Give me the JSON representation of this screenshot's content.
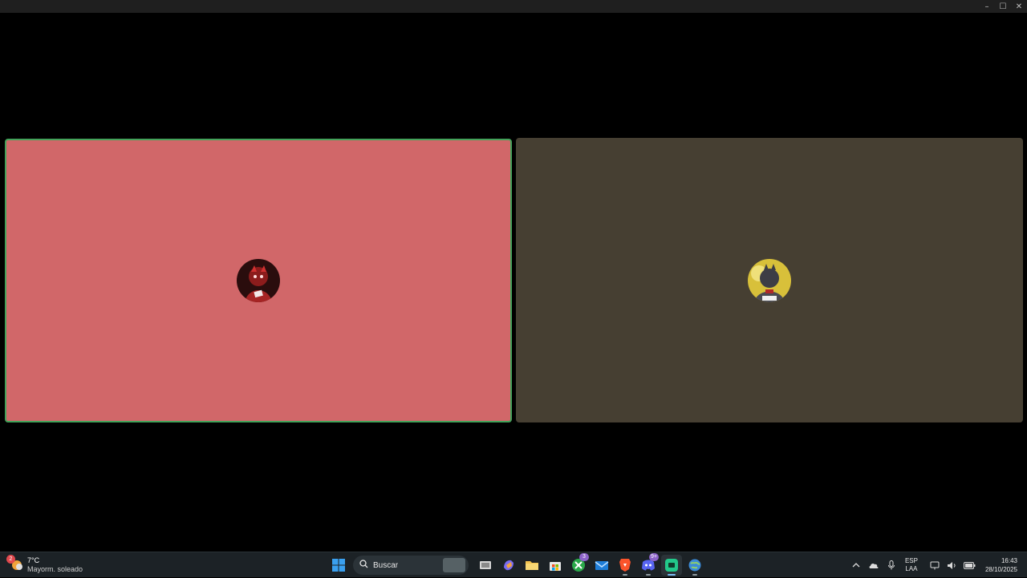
{
  "window": {
    "minimize_glyph": "–",
    "maximize_glyph": "☐",
    "close_glyph": "✕"
  },
  "call": {
    "participants": [
      {
        "tile_color": "#d16769",
        "speaking": true,
        "avatar": "red-character-avatar"
      },
      {
        "tile_color": "#463f32",
        "speaking": false,
        "avatar": "yellow-character-avatar"
      }
    ],
    "speaking_border_color": "#43a25a"
  },
  "taskbar": {
    "weather": {
      "temp": "7°C",
      "condition": "Mayorm. soleado",
      "badge": "2"
    },
    "search": {
      "placeholder": "Buscar"
    },
    "apps": [
      {
        "name": "start-icon"
      },
      {
        "name": "task-view-icon"
      },
      {
        "name": "copilot-icon"
      },
      {
        "name": "file-explorer-icon"
      },
      {
        "name": "microsoft-store-icon"
      },
      {
        "name": "xbox-icon",
        "badge": "3"
      },
      {
        "name": "mail-icon"
      },
      {
        "name": "brave-browser-icon"
      },
      {
        "name": "discord-icon",
        "badge": "9+"
      },
      {
        "name": "active-app-icon"
      },
      {
        "name": "globe-app-icon"
      }
    ],
    "tray": {
      "language_top": "ESP",
      "language_bottom": "LAA",
      "time": "16:43",
      "date": "28/10/2025"
    }
  }
}
